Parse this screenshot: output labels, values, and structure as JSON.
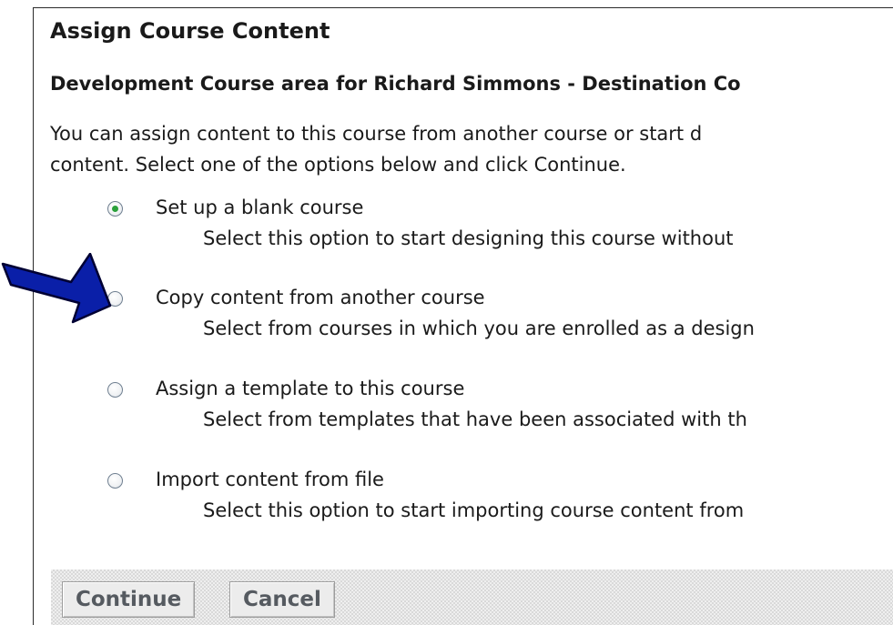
{
  "header": {
    "title": "Assign Course Content",
    "subtitle": "Development Course area for Richard Simmons - Destination Co"
  },
  "intro": {
    "line1": "You can assign content to this course from another course or start d",
    "line2": "content. Select one of the options below and click Continue."
  },
  "options": [
    {
      "label": "Set up a blank course",
      "description": "Select this option to start designing this course without",
      "selected": true
    },
    {
      "label": "Copy content from another course",
      "description": "Select from courses in which you are enrolled as a design",
      "selected": false
    },
    {
      "label": "Assign a template to this course",
      "description": "Select from templates that have been associated with th",
      "selected": false
    },
    {
      "label": "Import content from file",
      "description": "Select this option to start importing course content from",
      "selected": false
    }
  ],
  "buttons": {
    "continue_label": "Continue",
    "cancel_label": "Cancel"
  },
  "colors": {
    "arrow_fill": "#0a1fa8",
    "arrow_stroke": "#000033",
    "radio_selected": "#2aa03a"
  },
  "icons": {
    "callout": "arrow-pointer-icon"
  }
}
